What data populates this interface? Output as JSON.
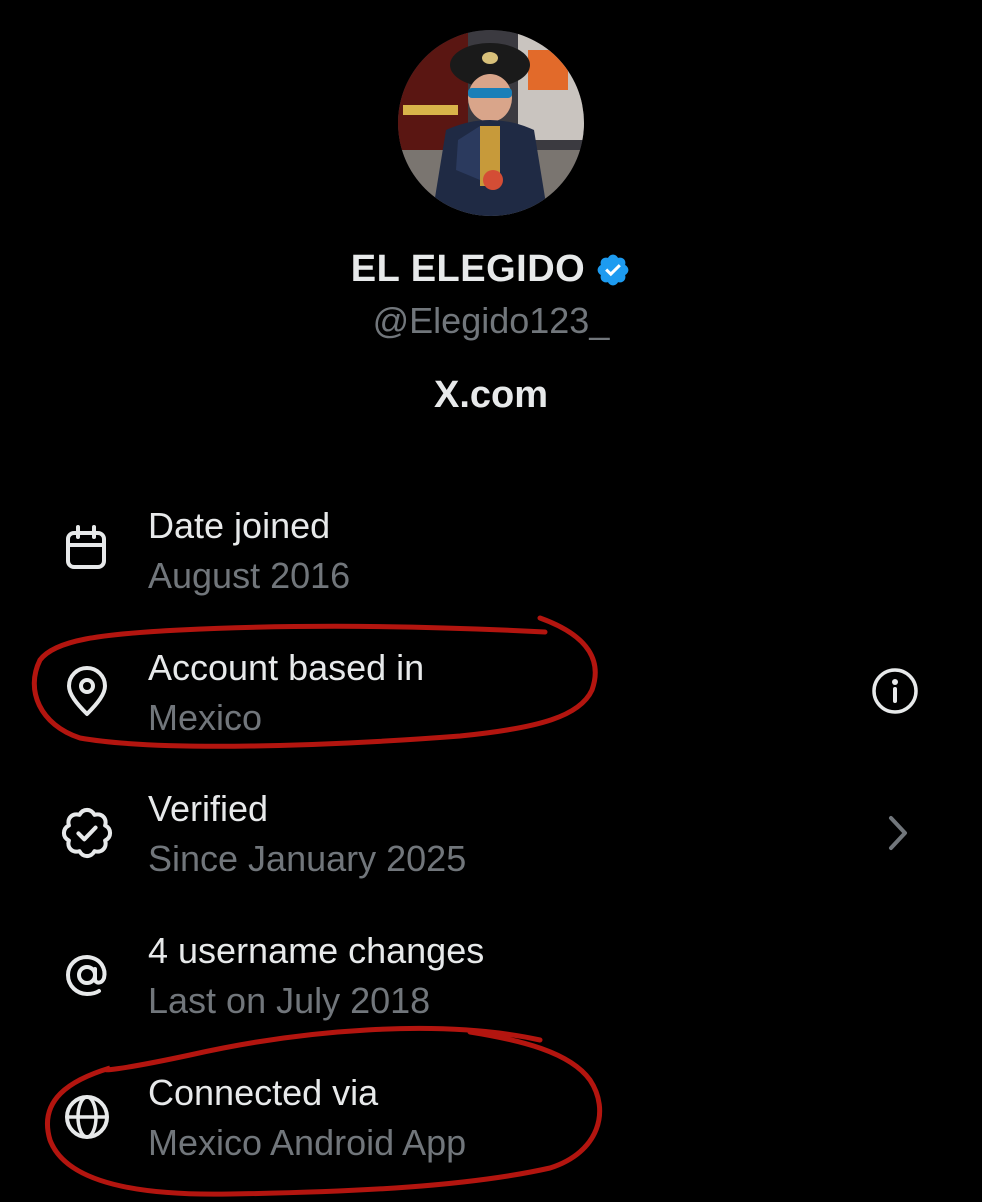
{
  "profile": {
    "display_name": "EL ELEGIDO",
    "handle": "@Elegido123_",
    "site": "X.com",
    "avatar_icon": "profile-avatar-photo",
    "verified_icon": "verified-badge-icon"
  },
  "info_rows": [
    {
      "title": "Date joined",
      "subtitle": "August 2016",
      "icon": "calendar-icon"
    },
    {
      "title": "Account based in",
      "subtitle": "Mexico",
      "icon": "location-pin-icon",
      "action_icon": "info-icon"
    },
    {
      "title": "Verified",
      "subtitle": "Since January 2025",
      "icon": "verified-check-icon",
      "action_icon": "chevron-right-icon"
    },
    {
      "title": "4 username changes",
      "subtitle": "Last on July 2018",
      "icon": "at-sign-icon"
    },
    {
      "title": "Connected via",
      "subtitle": "Mexico Android App",
      "icon": "globe-icon"
    }
  ],
  "colors": {
    "background": "#000000",
    "primary_text": "#e7e9ea",
    "secondary_text": "#71767b",
    "verified_blue": "#1d9bf0",
    "annotation_red": "#b3150f"
  }
}
